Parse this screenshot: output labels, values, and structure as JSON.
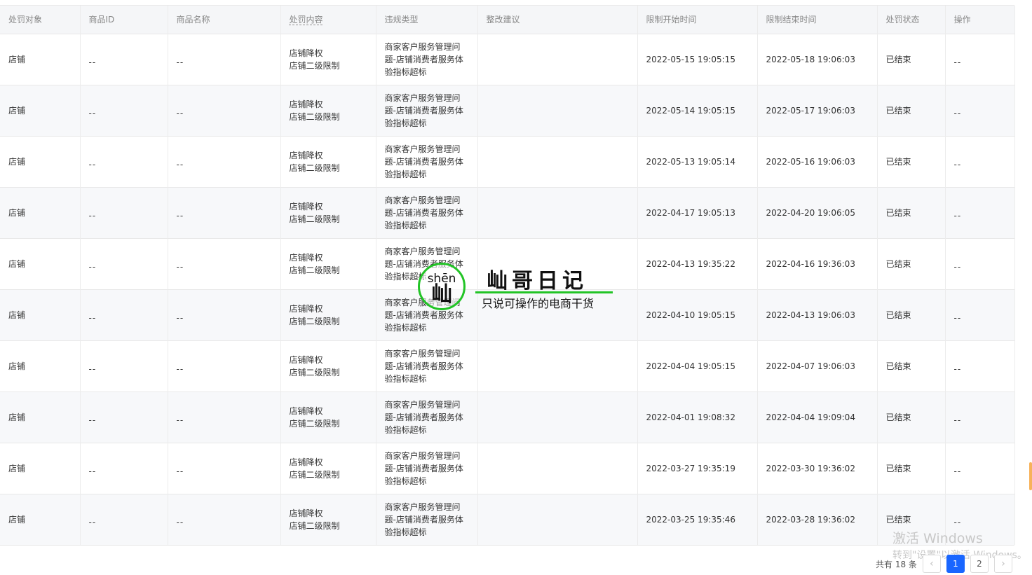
{
  "table": {
    "headers": [
      "处罚对象",
      "商品ID",
      "商品名称",
      "处罚内容",
      "违规类型",
      "整改建议",
      "限制开始时间",
      "限制结束时间",
      "处罚状态",
      "操作"
    ],
    "rows": [
      {
        "target": "店铺",
        "product_id": "--",
        "product_name": "--",
        "content": [
          "店铺降权",
          "店铺二级限制"
        ],
        "violation": [
          "商家客户服务管理问",
          "题-店铺消费者服务体",
          "验指标超标"
        ],
        "suggestion": "",
        "start": "2022-05-15 19:05:15",
        "end": "2022-05-18 19:06:03",
        "status": "已结束",
        "action": "--"
      },
      {
        "target": "店铺",
        "product_id": "--",
        "product_name": "--",
        "content": [
          "店铺降权",
          "店铺二级限制"
        ],
        "violation": [
          "商家客户服务管理问",
          "题-店铺消费者服务体",
          "验指标超标"
        ],
        "suggestion": "",
        "start": "2022-05-14 19:05:15",
        "end": "2022-05-17 19:06:03",
        "status": "已结束",
        "action": "--"
      },
      {
        "target": "店铺",
        "product_id": "--",
        "product_name": "--",
        "content": [
          "店铺降权",
          "店铺二级限制"
        ],
        "violation": [
          "商家客户服务管理问",
          "题-店铺消费者服务体",
          "验指标超标"
        ],
        "suggestion": "",
        "start": "2022-05-13 19:05:14",
        "end": "2022-05-16 19:06:03",
        "status": "已结束",
        "action": "--"
      },
      {
        "target": "店铺",
        "product_id": "--",
        "product_name": "--",
        "content": [
          "店铺降权",
          "店铺二级限制"
        ],
        "violation": [
          "商家客户服务管理问",
          "题-店铺消费者服务体",
          "验指标超标"
        ],
        "suggestion": "",
        "start": "2022-04-17 19:05:13",
        "end": "2022-04-20 19:06:05",
        "status": "已结束",
        "action": "--"
      },
      {
        "target": "店铺",
        "product_id": "--",
        "product_name": "--",
        "content": [
          "店铺降权",
          "店铺二级限制"
        ],
        "violation": [
          "商家客户服务管理问",
          "题-店铺消费者服务体",
          "验指标超标"
        ],
        "suggestion": "",
        "start": "2022-04-13 19:35:22",
        "end": "2022-04-16 19:36:03",
        "status": "已结束",
        "action": "--"
      },
      {
        "target": "店铺",
        "product_id": "--",
        "product_name": "--",
        "content": [
          "店铺降权",
          "店铺二级限制"
        ],
        "violation": [
          "商家客户服务管理问",
          "题-店铺消费者服务体",
          "验指标超标"
        ],
        "suggestion": "",
        "start": "2022-04-10 19:05:15",
        "end": "2022-04-13 19:06:03",
        "status": "已结束",
        "action": "--"
      },
      {
        "target": "店铺",
        "product_id": "--",
        "product_name": "--",
        "content": [
          "店铺降权",
          "店铺二级限制"
        ],
        "violation": [
          "商家客户服务管理问",
          "题-店铺消费者服务体",
          "验指标超标"
        ],
        "suggestion": "",
        "start": "2022-04-04 19:05:15",
        "end": "2022-04-07 19:06:03",
        "status": "已结束",
        "action": "--"
      },
      {
        "target": "店铺",
        "product_id": "--",
        "product_name": "--",
        "content": [
          "店铺降权",
          "店铺二级限制"
        ],
        "violation": [
          "商家客户服务管理问",
          "题-店铺消费者服务体",
          "验指标超标"
        ],
        "suggestion": "",
        "start": "2022-04-01 19:08:32",
        "end": "2022-04-04 19:09:04",
        "status": "已结束",
        "action": "--"
      },
      {
        "target": "店铺",
        "product_id": "--",
        "product_name": "--",
        "content": [
          "店铺降权",
          "店铺二级限制"
        ],
        "violation": [
          "商家客户服务管理问",
          "题-店铺消费者服务体",
          "验指标超标"
        ],
        "suggestion": "",
        "start": "2022-03-27 19:35:19",
        "end": "2022-03-30 19:36:02",
        "status": "已结束",
        "action": "--"
      },
      {
        "target": "店铺",
        "product_id": "--",
        "product_name": "--",
        "content": [
          "店铺降权",
          "店铺二级限制"
        ],
        "violation": [
          "商家客户服务管理问",
          "题-店铺消费者服务体",
          "验指标超标"
        ],
        "suggestion": "",
        "start": "2022-03-25 19:35:46",
        "end": "2022-03-28 19:36:02",
        "status": "已结束",
        "action": "--"
      }
    ]
  },
  "watermark": {
    "pinyin": "shēn",
    "glyph": "屾",
    "title": "屾哥日记",
    "subtitle": "只说可操作的电商干货",
    "accent_color": "#22c426"
  },
  "os_watermark": {
    "title": "激活 Windows",
    "subtitle": "转到\"设置\"以激活 Windows。"
  },
  "pagination": {
    "total_label": "共有 18 条",
    "prev_icon": "chevron-left-icon",
    "next_icon": "chevron-right-icon",
    "prev_symbol": "‹",
    "next_symbol": "›",
    "pages": [
      "1",
      "2"
    ],
    "current_page": "1",
    "accent_color": "#1966ff"
  }
}
